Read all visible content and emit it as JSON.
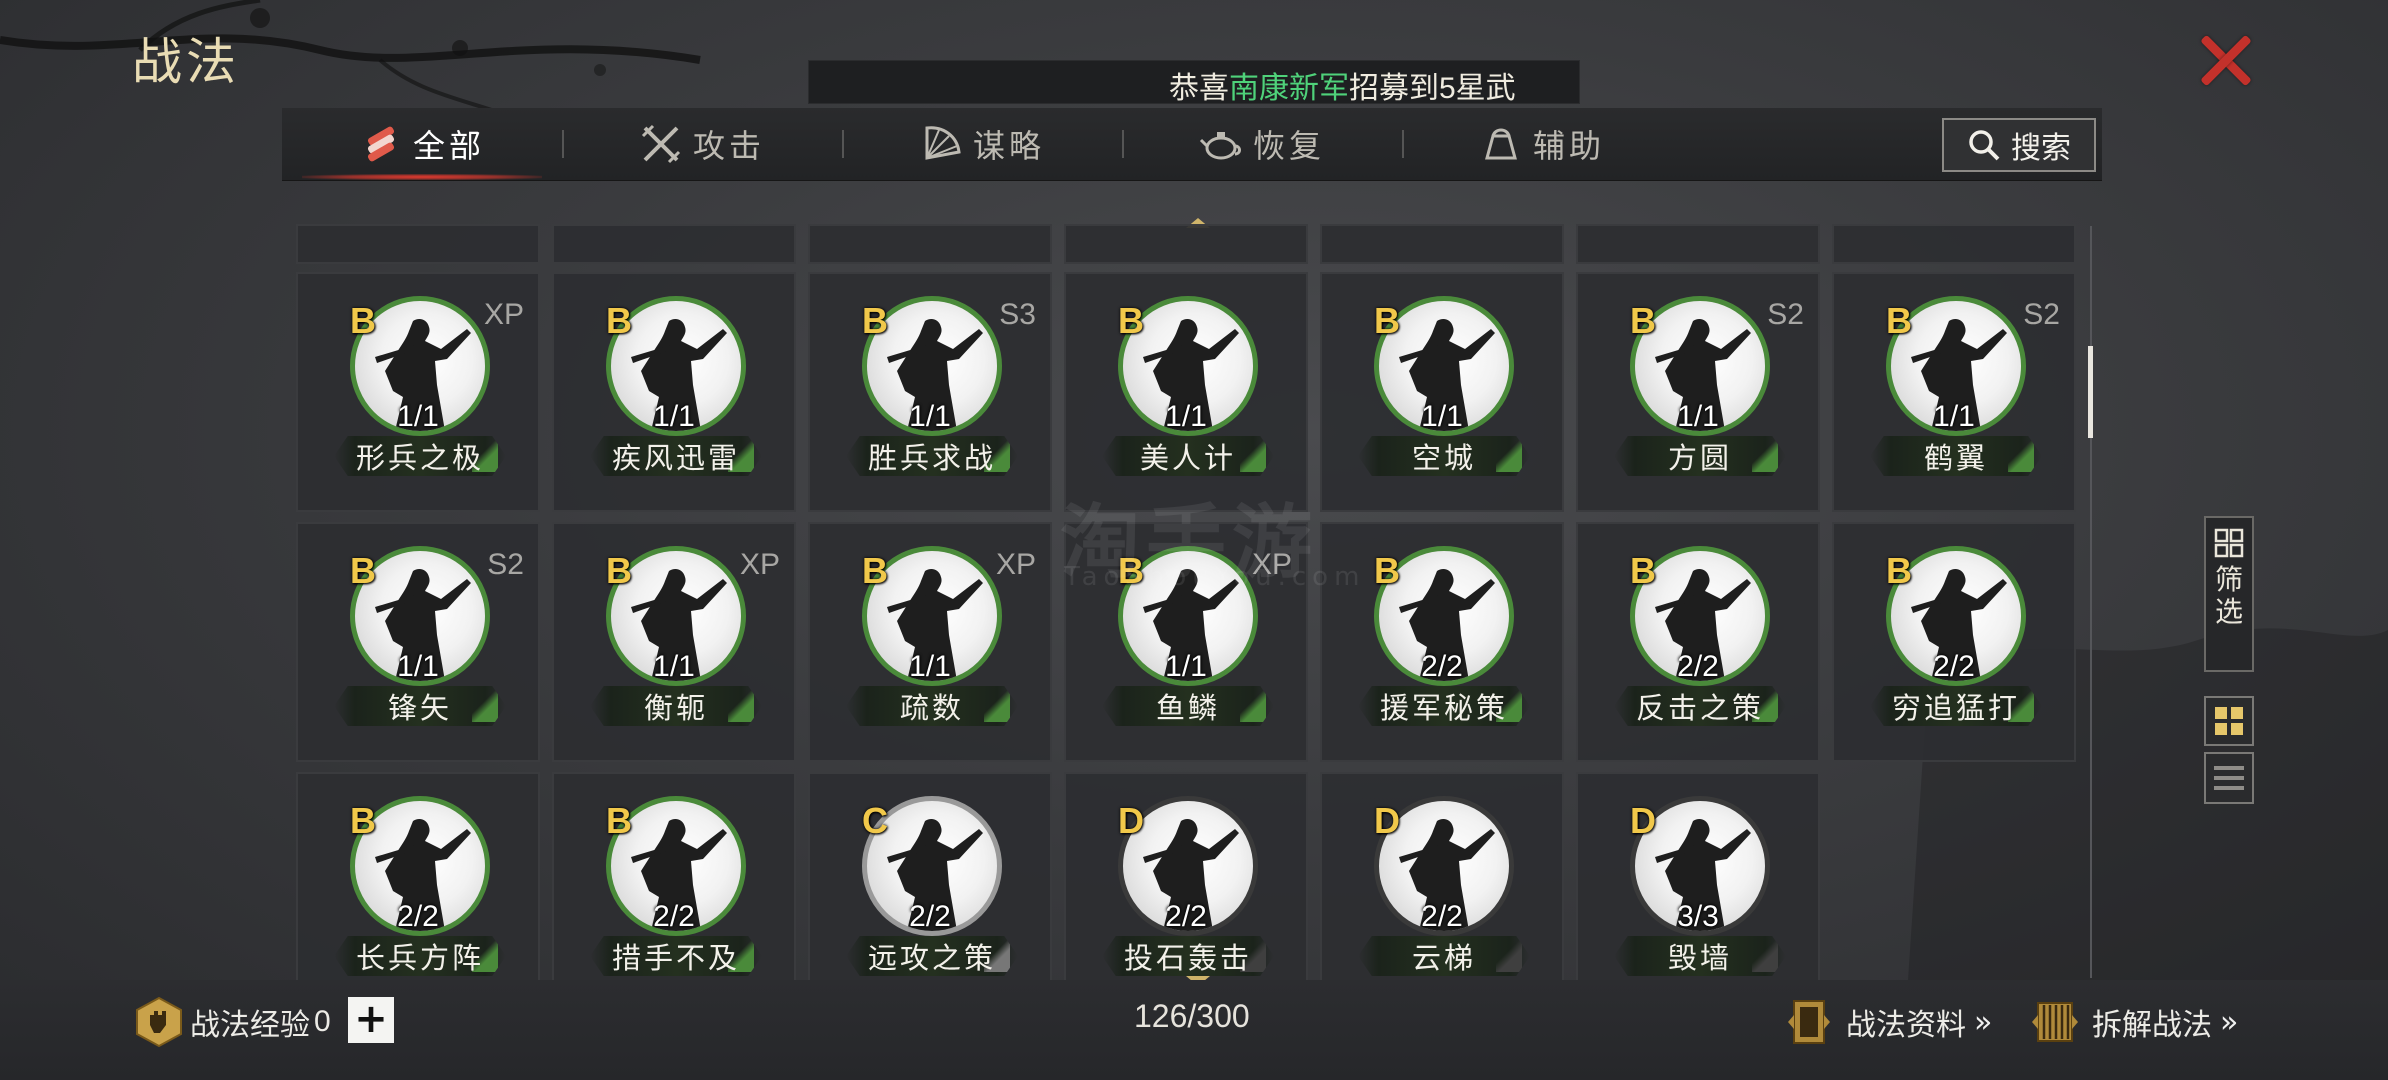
{
  "header": {
    "title": "战法",
    "ticker": {
      "prefix": "恭喜",
      "highlight": "南康新军",
      "suffix": "招募到5星武"
    }
  },
  "tabs": [
    {
      "label": "全部",
      "icon": "scroll-bundle-icon",
      "active": true
    },
    {
      "label": "攻击",
      "icon": "crossed-swords-icon",
      "active": false
    },
    {
      "label": "谋略",
      "icon": "fan-icon",
      "active": false
    },
    {
      "label": "恢复",
      "icon": "teapot-icon",
      "active": false
    },
    {
      "label": "辅助",
      "icon": "pouch-icon",
      "active": false
    }
  ],
  "search": {
    "label": "搜索"
  },
  "grid": {
    "rows": [
      [
        {
          "grade": "B",
          "tag": "XP",
          "count": "1/1",
          "name": "形兵之极"
        },
        {
          "grade": "B",
          "tag": "",
          "count": "1/1",
          "name": "疾风迅雷"
        },
        {
          "grade": "B",
          "tag": "S3",
          "count": "1/1",
          "name": "胜兵求战"
        },
        {
          "grade": "B",
          "tag": "",
          "count": "1/1",
          "name": "美人计"
        },
        {
          "grade": "B",
          "tag": "",
          "count": "1/1",
          "name": "空城"
        },
        {
          "grade": "B",
          "tag": "S2",
          "count": "1/1",
          "name": "方圆"
        },
        {
          "grade": "B",
          "tag": "S2",
          "count": "1/1",
          "name": "鹤翼"
        }
      ],
      [
        {
          "grade": "B",
          "tag": "S2",
          "count": "1/1",
          "name": "锋矢"
        },
        {
          "grade": "B",
          "tag": "XP",
          "count": "1/1",
          "name": "衡轭"
        },
        {
          "grade": "B",
          "tag": "XP",
          "count": "1/1",
          "name": "疏数"
        },
        {
          "grade": "B",
          "tag": "XP",
          "count": "1/1",
          "name": "鱼鳞"
        },
        {
          "grade": "B",
          "tag": "",
          "count": "2/2",
          "name": "援军秘策"
        },
        {
          "grade": "B",
          "tag": "",
          "count": "2/2",
          "name": "反击之策"
        },
        {
          "grade": "B",
          "tag": "",
          "count": "2/2",
          "name": "穷追猛打"
        }
      ],
      [
        {
          "grade": "B",
          "tag": "",
          "count": "2/2",
          "name": "长兵方阵"
        },
        {
          "grade": "B",
          "tag": "",
          "count": "2/2",
          "name": "措手不及"
        },
        {
          "grade": "C",
          "tag": "",
          "count": "2/2",
          "name": "远攻之策"
        },
        {
          "grade": "D",
          "tag": "",
          "count": "2/2",
          "name": "投石轰击"
        },
        {
          "grade": "D",
          "tag": "",
          "count": "2/2",
          "name": "云梯"
        },
        {
          "grade": "D",
          "tag": "",
          "count": "3/3",
          "name": "毁墙"
        }
      ]
    ]
  },
  "watermark": {
    "main": "淘手游",
    "sub": "TaoShouYou.com"
  },
  "side": {
    "filter_label": "筛选"
  },
  "footer": {
    "exp_label": "战法经验",
    "exp_value": "0",
    "plus": "+",
    "capacity": "126/300",
    "info_link": "战法资料",
    "dismantle_link": "拆解战法",
    "arrow": "»"
  },
  "colors": {
    "accent_red": "#c3312b",
    "grade_gold": "#f1c84a",
    "ring_b": "#4a8a3a",
    "ring_c": "#999999",
    "ring_d": "#3a3a3a",
    "ticker_highlight": "#4fd27a"
  }
}
